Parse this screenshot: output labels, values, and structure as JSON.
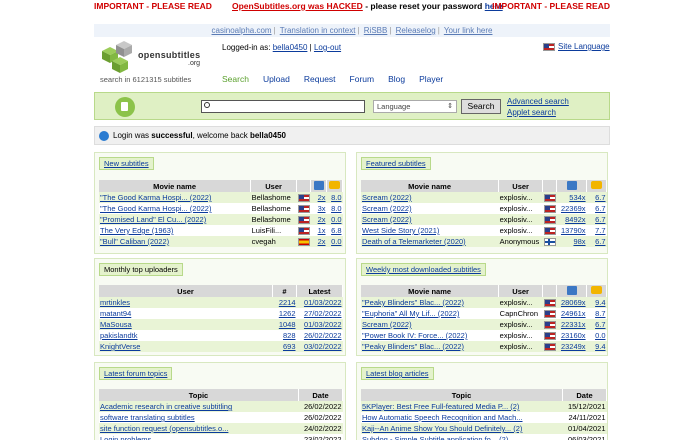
{
  "banner": {
    "left": "IMPORTANT - PLEASE READ",
    "middle_link": "OpenSubtitles.org was HACKED",
    "middle_text": " - please reset your password ",
    "middle_here": "here",
    "right": "IMPORTANT - PLEASE READ"
  },
  "links": [
    "casinoalpha.com",
    "Translation in context",
    "RiSBB",
    "Releaselog",
    "Your link here"
  ],
  "logo": {
    "brand": "opensubtitles",
    "tld": ".org"
  },
  "search_count": "search in 6121315 subtitles",
  "user": {
    "logged_prefix": "Logged-in as: ",
    "name": "bella0450",
    "sep": " | ",
    "logout": "Log-out"
  },
  "site_language": "Site Language",
  "nav": [
    "Search",
    "Upload",
    "Request",
    "Forum",
    "Blog",
    "Player"
  ],
  "search": {
    "placeholder": "",
    "language": "Language",
    "button": "Search",
    "advanced": "Advanced search",
    "applet": "Applet search"
  },
  "welcome": {
    "pre": "Login was ",
    "bold": "successful",
    "mid": ", welcome back ",
    "name": "bella0450"
  },
  "new_subtitles": {
    "title": "New subtitles",
    "headers": [
      "Movie name",
      "User"
    ],
    "rows": [
      {
        "name": "\"The Good Karma Hospi... (2022)",
        "user": "Bellashome",
        "flag": "uk",
        "dl": "2x",
        "rating": "8.0"
      },
      {
        "name": "\"The Good Karma Hospi... (2022)",
        "user": "Bellashome",
        "flag": "uk",
        "dl": "3x",
        "rating": "8.0"
      },
      {
        "name": "\"Promised Land\" El Cu... (2022)",
        "user": "Bellashome",
        "flag": "uk",
        "dl": "2x",
        "rating": "0.0"
      },
      {
        "name": "The Very Edge (1963)",
        "user": "LuisFili...",
        "flag": "uk",
        "dl": "1x",
        "rating": "6.8"
      },
      {
        "name": "\"Bull\" Caliban (2022)",
        "user": "cvegah",
        "flag": "es",
        "dl": "2x",
        "rating": "0.0"
      }
    ]
  },
  "featured": {
    "title": "Featured subtitles",
    "headers": [
      "Movie name",
      "User"
    ],
    "rows": [
      {
        "name": "Scream (2022)",
        "user": "explosiv...",
        "flag": "uk",
        "dl": "534x",
        "rating": "6.7"
      },
      {
        "name": "Scream (2022)",
        "user": "explosiv...",
        "flag": "uk",
        "dl": "22369x",
        "rating": "6.7"
      },
      {
        "name": "Scream (2022)",
        "user": "explosiv...",
        "flag": "uk",
        "dl": "8492x",
        "rating": "6.7"
      },
      {
        "name": "West Side Story (2021)",
        "user": "explosiv...",
        "flag": "uk",
        "dl": "13790x",
        "rating": "7.7"
      },
      {
        "name": "Death of a Telemarketer (2020)",
        "user": "Anonymous",
        "flag": "fi",
        "dl": "98x",
        "rating": "6.7"
      }
    ]
  },
  "uploaders": {
    "title": "Monthly top uploaders",
    "headers": [
      "User",
      "#",
      "Latest"
    ],
    "rows": [
      {
        "user": "mrtinkles",
        "count": "2214",
        "latest": "01/03/2022"
      },
      {
        "user": "matant94",
        "count": "1262",
        "latest": "27/02/2022"
      },
      {
        "user": "MaSousa",
        "count": "1048",
        "latest": "01/03/2022"
      },
      {
        "user": "pakislandtk",
        "count": "828",
        "latest": "26/02/2022"
      },
      {
        "user": "KnightVerse",
        "count": "693",
        "latest": "03/02/2022"
      }
    ]
  },
  "weekly": {
    "title": "Weekly most downloaded subtitles",
    "headers": [
      "Movie name",
      "User"
    ],
    "rows": [
      {
        "name": "\"Peaky Blinders\" Blac... (2022)",
        "user": "explosiv...",
        "flag": "uk",
        "dl": "28069x",
        "rating": "9.4"
      },
      {
        "name": "\"Euphoria\" All My Lif... (2022)",
        "user": "CapnChron",
        "flag": "uk",
        "dl": "24961x",
        "rating": "8.7"
      },
      {
        "name": "Scream (2022)",
        "user": "explosiv...",
        "flag": "uk",
        "dl": "22331x",
        "rating": "6.7"
      },
      {
        "name": "\"Power Book IV: Force... (2022)",
        "user": "explosiv...",
        "flag": "uk",
        "dl": "23160x",
        "rating": "0.0"
      },
      {
        "name": "\"Peaky Blinders\" Blac... (2022)",
        "user": "explosiv...",
        "flag": "uk",
        "dl": "23249x",
        "rating": "9.4"
      }
    ]
  },
  "forum": {
    "title": "Latest forum topics",
    "headers": [
      "Topic",
      "Date"
    ],
    "rows": [
      {
        "topic": "Academic research in creative subtitling",
        "date": "26/02/2022"
      },
      {
        "topic": "software translating subtitles",
        "date": "26/02/2022"
      },
      {
        "topic": "site function request (opensubtitles.o...",
        "date": "24/02/2022"
      },
      {
        "topic": "Login problems",
        "date": "23/02/2022"
      }
    ]
  },
  "blog": {
    "title": "Latest blog articles",
    "headers": [
      "Topic",
      "Date"
    ],
    "rows": [
      {
        "topic": "5KPlayer: Best Free Full-featured Media P... (2)",
        "date": "15/12/2021"
      },
      {
        "topic": "How Automatic Speech Recognition and Mach...",
        "date": "24/11/2021"
      },
      {
        "topic": "Kaji--An Anime Show You Should Definitely... (2)",
        "date": "01/04/2021"
      },
      {
        "topic": "Subdog - Simple Subtitle application fo... (2)",
        "date": "06/03/2021"
      }
    ]
  }
}
